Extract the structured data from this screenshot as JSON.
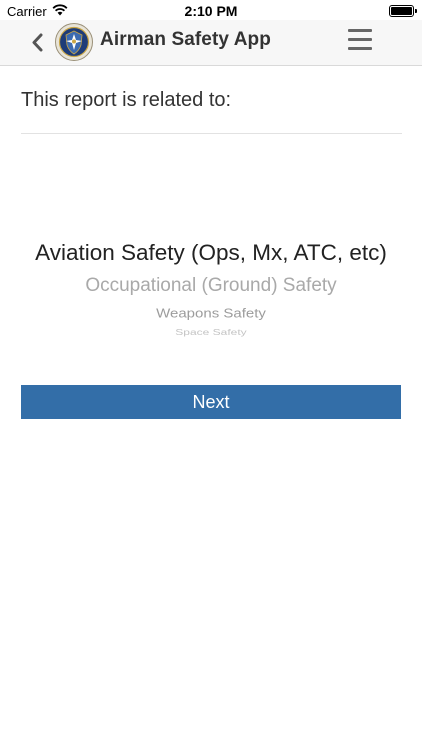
{
  "status_bar": {
    "carrier": "Carrier",
    "time": "2:10 PM"
  },
  "nav": {
    "title": "Airman Safety App",
    "back_icon": "chevron-left-icon",
    "menu_icon": "hamburger-menu-icon",
    "logo_icon": "air-force-safety-shield-logo"
  },
  "form": {
    "question": "This report is related to:",
    "picker_options": [
      "Aviation Safety (Ops, Mx, ATC, etc)",
      "Occupational (Ground) Safety",
      "Weapons Safety",
      "Space Safety"
    ],
    "selected_option": "Aviation Safety (Ops, Mx, ATC, etc)",
    "next_label": "Next"
  },
  "colors": {
    "button": "#336ea8",
    "nav_background": "#f7f7f7",
    "title_text": "#333333"
  }
}
